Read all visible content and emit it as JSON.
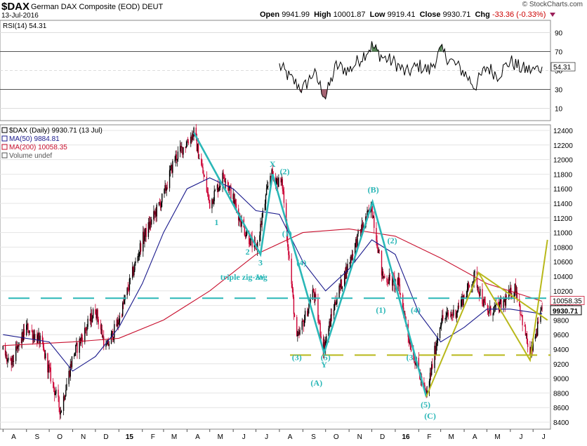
{
  "header": {
    "ticker": "$DAX",
    "company": "German DAX Composite (EOD) DEUT",
    "date": "13-Jul-2016",
    "logo": "© StockCharts.com",
    "open_label": "Open",
    "open": "9941.99",
    "high_label": "High",
    "high": "10001.87",
    "low_label": "Low",
    "low": "9919.41",
    "close_label": "Close",
    "close": "9930.71",
    "chg_label": "Chg",
    "chg": "-33.36 (-0.33%)"
  },
  "colors": {
    "up": "#000000",
    "down": "#cc0033",
    "ma50": "#1a1a8c",
    "ma200": "#c8102e",
    "wave": "#2ab7b7",
    "pattern": "#b8b81a",
    "rsi": "#000000",
    "rsi_fill_ob": "#4a7a4a",
    "rsi_fill_os": "#a05a6a"
  },
  "chart_data": [
    {
      "type": "line",
      "panel": "RSI",
      "title": "RSI(14) 54.31",
      "ylim": [
        0,
        100
      ],
      "y_ticks": [
        "90",
        "70",
        "50",
        "30",
        "10"
      ],
      "levels": [
        70,
        30
      ],
      "last_value": "54.31",
      "x": [
        "2015-08-01",
        "2015-08-15",
        "2015-09-01",
        "2015-09-15",
        "2015-10-01",
        "2015-10-15",
        "2015-11-01",
        "2015-11-15",
        "2015-12-01",
        "2015-12-15",
        "2016-01-01",
        "2016-01-15",
        "2016-02-01",
        "2016-02-15",
        "2016-03-01",
        "2016-03-15",
        "2016-04-01",
        "2016-04-15",
        "2016-05-01",
        "2016-05-15",
        "2016-06-01",
        "2016-06-15",
        "2016-07-01",
        "2016-07-13"
      ],
      "values": [
        55,
        42,
        30,
        48,
        22,
        55,
        50,
        62,
        76,
        64,
        58,
        47,
        55,
        50,
        71,
        60,
        48,
        33,
        54,
        45,
        60,
        52,
        50,
        54
      ],
      "grid": true
    },
    {
      "type": "candlestick",
      "panel": "price",
      "legend": [
        "$DAX (Daily) 9930.71 (13 Jul)",
        "MA(50) 9884.81",
        "MA(200) 10058.35",
        "Volume undef"
      ],
      "ylim": [
        8400,
        12400
      ],
      "y_ticks": [
        "12400",
        "12200",
        "12000",
        "11800",
        "11600",
        "11400",
        "11200",
        "11000",
        "10800",
        "10600",
        "10400",
        "10200",
        "10000",
        "9800",
        "9600",
        "9400",
        "9200",
        "9000",
        "8800",
        "8600",
        "8400"
      ],
      "x_ticks": [
        "A",
        "S",
        "O",
        "N",
        "D",
        "15",
        "F",
        "M",
        "A",
        "M",
        "J",
        "J",
        "A",
        "S",
        "O",
        "N",
        "D",
        "16",
        "F",
        "M",
        "A",
        "M",
        "J",
        "J"
      ],
      "last_price_labels": [
        "10058.35",
        "9930.71"
      ],
      "price_path": [
        [
          "2014-08-01",
          9400
        ],
        [
          "2014-08-10",
          9150
        ],
        [
          "2014-09-01",
          9700
        ],
        [
          "2014-09-20",
          9500
        ],
        [
          "2014-10-16",
          8550
        ],
        [
          "2014-11-01",
          9300
        ],
        [
          "2014-12-01",
          9950
        ],
        [
          "2014-12-15",
          9400
        ],
        [
          "2015-01-01",
          9800
        ],
        [
          "2015-02-01",
          10900
        ],
        [
          "2015-03-01",
          11500
        ],
        [
          "2015-03-15",
          12000
        ],
        [
          "2015-04-10",
          12370
        ],
        [
          "2015-05-01",
          11400
        ],
        [
          "2015-05-20",
          11800
        ],
        [
          "2015-06-15",
          11050
        ],
        [
          "2015-07-01",
          10750
        ],
        [
          "2015-07-20",
          11800
        ],
        [
          "2015-08-05",
          11650
        ],
        [
          "2015-08-24",
          9500
        ],
        [
          "2015-09-15",
          10200
        ],
        [
          "2015-09-28",
          9400
        ],
        [
          "2015-10-15",
          10100
        ],
        [
          "2015-11-15",
          11000
        ],
        [
          "2015-12-01",
          11350
        ],
        [
          "2015-12-15",
          10400
        ],
        [
          "2016-01-05",
          10300
        ],
        [
          "2016-01-20",
          9500
        ],
        [
          "2016-02-11",
          8750
        ],
        [
          "2016-03-01",
          9800
        ],
        [
          "2016-03-20",
          9900
        ],
        [
          "2016-04-15",
          10400
        ],
        [
          "2016-05-01",
          9900
        ],
        [
          "2016-05-20",
          10000
        ],
        [
          "2016-06-08",
          10250
        ],
        [
          "2016-06-27",
          9300
        ],
        [
          "2016-07-13",
          9930
        ]
      ],
      "ma50": [
        [
          "2014-08-01",
          9600
        ],
        [
          "2014-10-01",
          9500
        ],
        [
          "2014-11-01",
          9100
        ],
        [
          "2014-12-01",
          9300
        ],
        [
          "2015-01-01",
          9700
        ],
        [
          "2015-02-01",
          10300
        ],
        [
          "2015-03-01",
          11000
        ],
        [
          "2015-04-01",
          11600
        ],
        [
          "2015-05-01",
          11750
        ],
        [
          "2015-06-01",
          11600
        ],
        [
          "2015-07-01",
          11300
        ],
        [
          "2015-08-01",
          11250
        ],
        [
          "2015-09-01",
          10600
        ],
        [
          "2015-10-01",
          10200
        ],
        [
          "2015-11-01",
          10500
        ],
        [
          "2015-12-01",
          10900
        ],
        [
          "2016-01-01",
          10700
        ],
        [
          "2016-02-01",
          9900
        ],
        [
          "2016-03-01",
          9500
        ],
        [
          "2016-04-01",
          9700
        ],
        [
          "2016-05-01",
          9950
        ],
        [
          "2016-06-01",
          9950
        ],
        [
          "2016-07-13",
          9885
        ]
      ],
      "ma200": [
        [
          "2014-08-01",
          9450
        ],
        [
          "2014-11-01",
          9500
        ],
        [
          "2015-01-01",
          9550
        ],
        [
          "2015-03-01",
          9800
        ],
        [
          "2015-05-01",
          10200
        ],
        [
          "2015-07-01",
          10700
        ],
        [
          "2015-09-01",
          11000
        ],
        [
          "2015-11-01",
          11050
        ],
        [
          "2016-01-01",
          10950
        ],
        [
          "2016-03-01",
          10650
        ],
        [
          "2016-05-01",
          10300
        ],
        [
          "2016-07-13",
          10058
        ]
      ],
      "horizontal_lines": [
        {
          "name": "dashed-teal",
          "value": 10100,
          "color": "#2ab7b7"
        },
        {
          "name": "dashed-yellow",
          "value": 9320,
          "color": "#b8b81a"
        }
      ],
      "wave_path": [
        [
          "2015-04-10",
          12370
        ],
        [
          "2015-07-07",
          10700
        ],
        [
          "2015-07-23",
          11800
        ],
        [
          "2015-09-29",
          9350
        ],
        [
          "2015-12-02",
          11420
        ],
        [
          "2016-02-11",
          8750
        ]
      ],
      "pattern_path": [
        [
          "2016-02-11",
          8750
        ],
        [
          "2016-04-20",
          10450
        ],
        [
          "2016-06-27",
          9250
        ],
        [
          "2016-07-20",
          10900
        ]
      ],
      "annotations": [
        {
          "text": "X",
          "date": "2015-07-23",
          "value": 11900
        },
        {
          "text": "(2)",
          "date": "2015-08-08",
          "value": 11800
        },
        {
          "text": "1",
          "date": "2015-05-10",
          "value": 11100
        },
        {
          "text": "2",
          "date": "2015-06-20",
          "value": 10700
        },
        {
          "text": "3",
          "date": "2015-07-07",
          "value": 10550
        },
        {
          "text": "W",
          "date": "2015-07-07",
          "value": 10350
        },
        {
          "text": "triple zig-zag",
          "date": "2015-06-15",
          "value": 10350
        },
        {
          "text": "(1)",
          "date": "2015-08-11",
          "value": 10950
        },
        {
          "text": "(4)",
          "date": "2015-08-30",
          "value": 10550
        },
        {
          "text": "(3)",
          "date": "2015-08-24",
          "value": 9250
        },
        {
          "text": "(5)",
          "date": "2015-10-01",
          "value": 9250
        },
        {
          "text": "Y",
          "date": "2015-09-29",
          "value": 9150
        },
        {
          "text": "(A)",
          "date": "2015-09-19",
          "value": 8900
        },
        {
          "text": "(B)",
          "date": "2015-12-03",
          "value": 11550
        },
        {
          "text": "(2)",
          "date": "2015-12-28",
          "value": 10850
        },
        {
          "text": "(1)",
          "date": "2015-12-13",
          "value": 9900
        },
        {
          "text": "(4)",
          "date": "2016-01-28",
          "value": 9900
        },
        {
          "text": "(3)",
          "date": "2016-01-22",
          "value": 9250
        },
        {
          "text": "(5)",
          "date": "2016-02-10",
          "value": 8600
        },
        {
          "text": "(C)",
          "date": "2016-02-16",
          "value": 8450
        }
      ]
    }
  ]
}
